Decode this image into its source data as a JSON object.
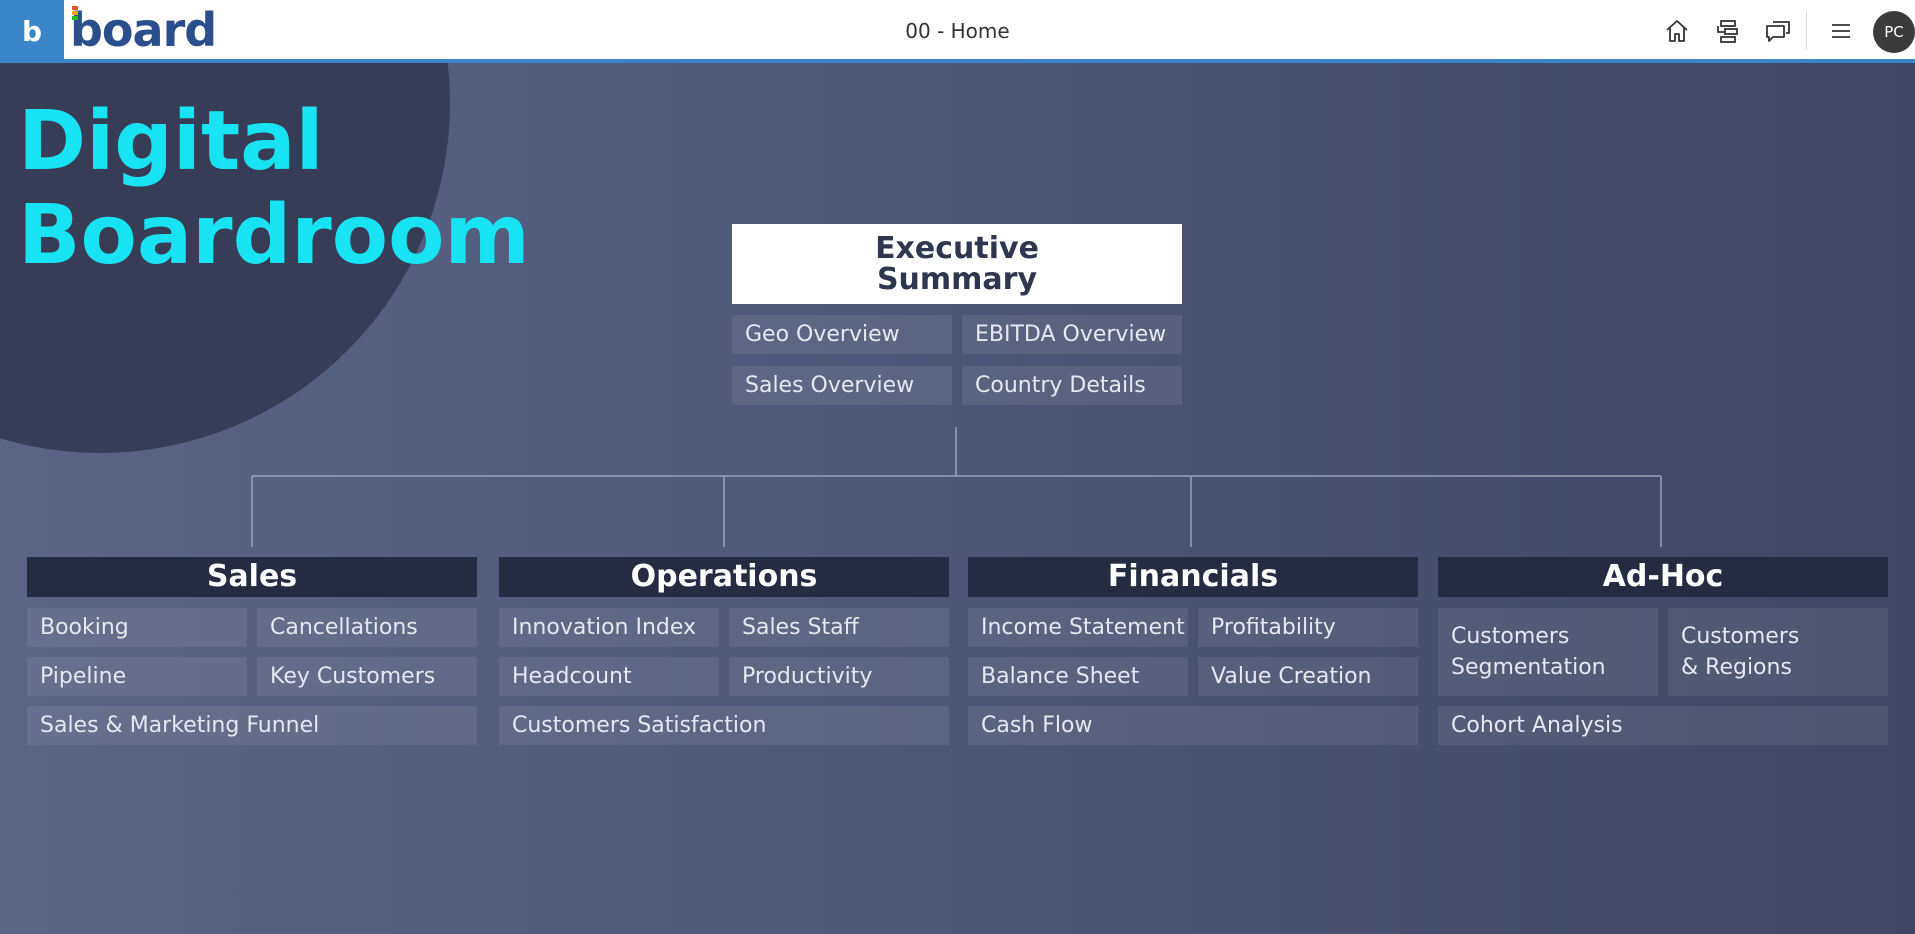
{
  "topbar": {
    "brand_letter": "b",
    "brand_name": "board",
    "page_title": "00 - Home",
    "avatar_initials": "PC",
    "colors": {
      "accent": "#3a86c8",
      "logo": "#2b4f8c",
      "logo_dots": [
        "#e4572e",
        "#f3a712",
        "#29bf12"
      ]
    },
    "icons": [
      "home-icon",
      "hierarchy-icon",
      "chat-icon",
      "menu-icon"
    ]
  },
  "hero": {
    "line1": "Digital",
    "line2": "Boardroom",
    "color": "#18e3f2"
  },
  "executive": {
    "title_line1": "Executive",
    "title_line2": "Summary",
    "links": [
      "Geo Overview",
      "EBITDA Overview",
      "Sales Overview",
      "Country Details"
    ]
  },
  "sections": {
    "sales": {
      "title": "Sales",
      "links": [
        "Booking",
        "Cancellations",
        "Pipeline",
        "Key Customers",
        "Sales & Marketing Funnel"
      ]
    },
    "operations": {
      "title": "Operations",
      "links": [
        "Innovation Index",
        "Sales Staff",
        "Headcount",
        "Productivity",
        "Customers Satisfaction"
      ]
    },
    "financials": {
      "title": "Financials",
      "links": [
        "Income Statement",
        "Profitability",
        "Balance Sheet",
        "Value Creation",
        "Cash Flow"
      ]
    },
    "adhoc": {
      "title": "Ad-Hoc",
      "links": [
        {
          "line1": "Customers",
          "line2": "Segmentation"
        },
        {
          "line1": "Customers",
          "line2": "& Regions"
        },
        "Cohort Analysis"
      ]
    }
  }
}
